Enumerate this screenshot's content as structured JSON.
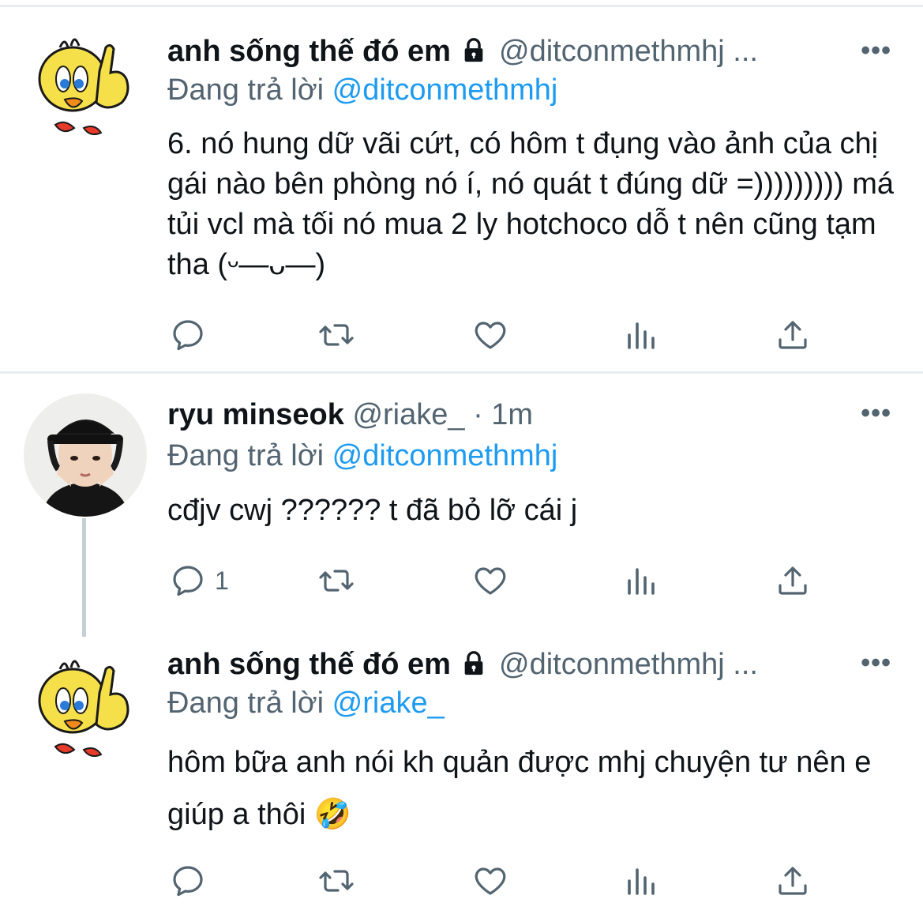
{
  "tweets": [
    {
      "author": "anh sống thế đó em",
      "handle": "@ditconmethmhj ...",
      "locked": true,
      "avatar_icon": "tweety-bird-avatar",
      "replying_prefix": "Đang trả lời",
      "replying_to": "@ditconmethmhj",
      "text": "6. nó hung dữ vãi cứt, có hôm t đụng vào ảnh của chị gái nào bên phòng nó í, nó quát t đúng dữ =))))))))) má tủi vcl mà tối nó mua 2 ly hotchoco dỗ t nên cũng tạm tha (ᵕ—ᴗ—)",
      "more_label": "•••",
      "reply_count": ""
    },
    {
      "author": "ryu minseok",
      "handle": "@riake_ · 1m",
      "locked": false,
      "avatar_icon": "person-photo-avatar",
      "replying_prefix": "Đang trả lời",
      "replying_to": "@ditconmethmhj",
      "text": "cđjv cwj ?????? t đã bỏ lỡ cái j",
      "more_label": "•••",
      "reply_count": "1"
    },
    {
      "author": "anh sống thế đó em",
      "handle": "@ditconmethmhj ...",
      "locked": true,
      "avatar_icon": "tweety-bird-avatar",
      "replying_prefix": "Đang trả lời",
      "replying_to": "@riake_",
      "text": "hôm bữa anh nói kh quản được mhj chuyện tư nên e giúp a thôi 🤣",
      "more_label": "•••",
      "reply_count": ""
    }
  ],
  "action_icons": [
    "reply-icon",
    "retweet-icon",
    "like-icon",
    "analytics-icon",
    "share-icon"
  ],
  "colors": {
    "text": "#0f1419",
    "secondary": "#536471",
    "link": "#1d9bf0",
    "divider": "#e6ecf0"
  }
}
